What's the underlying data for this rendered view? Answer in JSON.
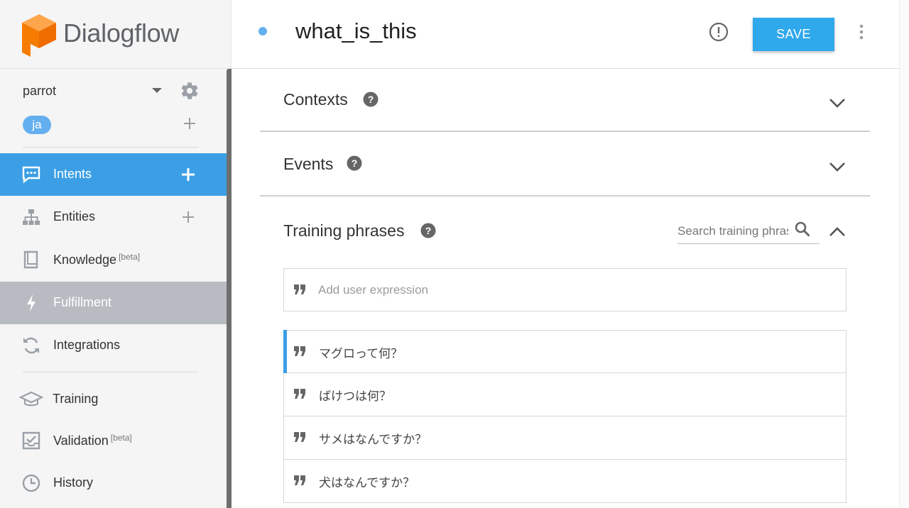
{
  "app": {
    "name": "Dialogflow"
  },
  "agent": {
    "name": "parrot",
    "language": "ja"
  },
  "nav": {
    "items": [
      {
        "key": "intents",
        "label": "Intents",
        "badge": ""
      },
      {
        "key": "entities",
        "label": "Entities",
        "badge": ""
      },
      {
        "key": "knowledge",
        "label": "Knowledge",
        "badge": "[beta]"
      },
      {
        "key": "fulfillment",
        "label": "Fulfillment",
        "badge": ""
      },
      {
        "key": "integrations",
        "label": "Integrations",
        "badge": ""
      },
      {
        "key": "training",
        "label": "Training",
        "badge": ""
      },
      {
        "key": "validation",
        "label": "Validation",
        "badge": "[beta]"
      },
      {
        "key": "history",
        "label": "History",
        "badge": ""
      }
    ]
  },
  "header": {
    "intent_name": "what_is_this",
    "save_label": "SAVE"
  },
  "sections": {
    "contexts": {
      "title": "Contexts"
    },
    "events": {
      "title": "Events"
    },
    "training": {
      "title": "Training phrases",
      "search_placeholder": "Search training phrases",
      "add_placeholder": "Add user expression",
      "phrases": [
        "マグロって何？",
        "ばけつは何？",
        "サメはなんですか？",
        "犬はなんですか？"
      ]
    }
  },
  "colors": {
    "accent": "#3c9fe6",
    "save": "#2fa8ec",
    "selected": "#b8bbc2",
    "logo": "#f58220"
  }
}
